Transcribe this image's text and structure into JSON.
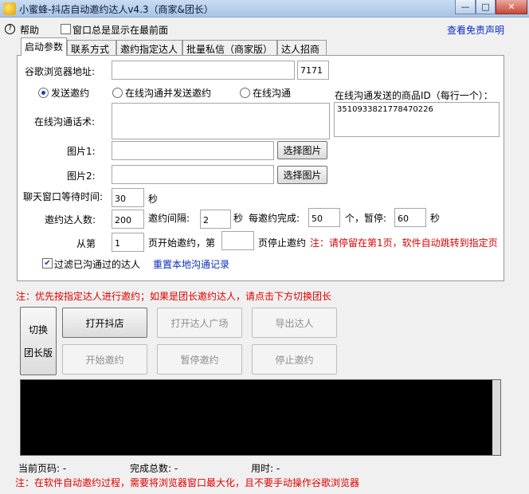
{
  "window": {
    "title": "小蜜蜂-抖店自动邀约达人v4.3（商家&团长）",
    "minimize": "—",
    "maximize": "□",
    "close": "✕"
  },
  "menu": {
    "help": "帮助",
    "always_top": "窗口总是显示在最前面",
    "disclaimer": "查看免责声明"
  },
  "tabs": [
    "启动参数",
    "联系方式",
    "邀约指定达人",
    "批量私信（商家版）",
    "达人招商"
  ],
  "form": {
    "browser_label": "谷歌浏览器地址:",
    "browser_value": "",
    "port_value": "7171",
    "radio_send": "发送邀约",
    "radio_chat_send": "在线沟通并发送邀约",
    "radio_chat": "在线沟通",
    "product_id_label": "在线沟通发送的商品ID（每行一个）：",
    "product_id_value": "3510933821778470226",
    "chat_script_label": "在线沟通话术:",
    "image1_label": "图片1:",
    "image2_label": "图片2:",
    "choose_image": "选择图片",
    "wait_label": "聊天窗口等待时间:",
    "wait_value": "30",
    "wait_unit": "秒",
    "invite_count_label": "邀约达人数:",
    "invite_count_value": "200",
    "interval_label": "邀约间隔:",
    "interval_value": "2",
    "interval_unit": "秒",
    "every_label": "每邀约完成:",
    "every_value": "50",
    "pause_label": "个，暂停:",
    "pause_value": "60",
    "pause_unit": "秒",
    "from_label": "从第",
    "from_value": "1",
    "start_page_label": "页开始邀约，第",
    "stop_value": "",
    "stop_page_label": "页停止邀约",
    "page_note": "注：请停留在第1页，软件自动跳转到指定页",
    "filter_label": "过滤已沟通过的达人",
    "reset_link": "重置本地沟通记录"
  },
  "notes": {
    "top": "注：优先按指定达人进行邀约；如果是团长邀约达人，请点击下方切换团长",
    "bottom": "注：在软件自动邀约过程，需要将浏览器窗口最大化，且不要手动操作谷歌浏览器"
  },
  "buttons": {
    "switch_line1": "切换",
    "switch_line2": "团长版",
    "open_douyin": "打开抖店",
    "open_plaza": "打开达人广场",
    "export": "导出达人",
    "start": "开始邀约",
    "pause": "暂停邀约",
    "stop": "停止邀约"
  },
  "status": {
    "current_page": "当前页码: -",
    "total_done": "完成总数: -",
    "time_used": "用时: -"
  }
}
